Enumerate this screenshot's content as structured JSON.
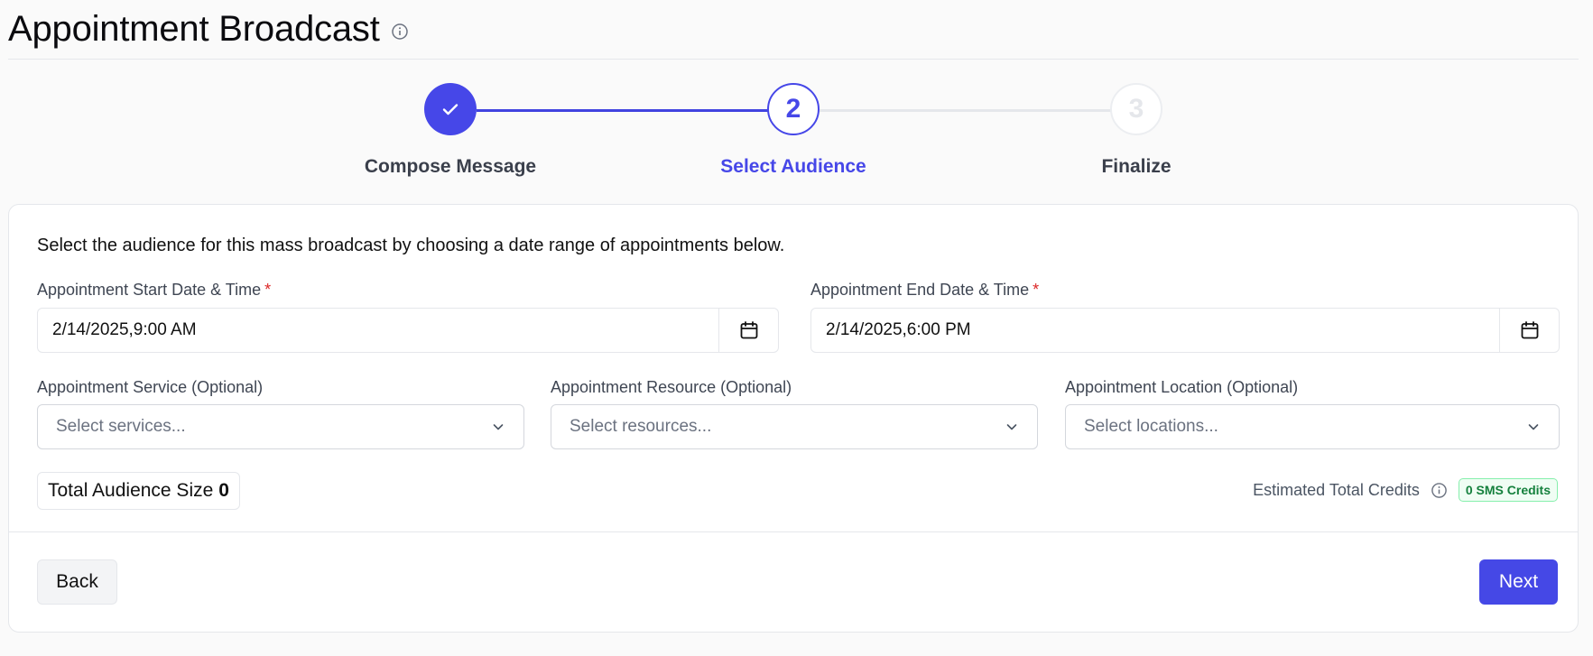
{
  "header": {
    "title": "Appointment Broadcast",
    "info_icon": "info-circle-icon"
  },
  "stepper": {
    "steps": [
      {
        "number": "",
        "label": "Compose Message",
        "state": "completed",
        "icon": "check-icon"
      },
      {
        "number": "2",
        "label": "Select Audience",
        "state": "active"
      },
      {
        "number": "3",
        "label": "Finalize",
        "state": "upcoming"
      }
    ]
  },
  "form": {
    "intro": "Select the audience for this mass broadcast by choosing a date range of appointments below.",
    "start": {
      "label": "Appointment Start Date & Time",
      "required_mark": "*",
      "value": "2/14/2025,9:00 AM",
      "icon": "calendar-icon"
    },
    "end": {
      "label": "Appointment End Date & Time",
      "required_mark": "*",
      "value": "2/14/2025,6:00 PM",
      "icon": "calendar-icon"
    },
    "service": {
      "label": "Appointment Service (Optional)",
      "placeholder": "Select services..."
    },
    "resource": {
      "label": "Appointment Resource (Optional)",
      "placeholder": "Select resources..."
    },
    "location": {
      "label": "Appointment Location (Optional)",
      "placeholder": "Select locations..."
    },
    "audience": {
      "label": "Total Audience Size",
      "count": "0"
    },
    "credits": {
      "label": "Estimated Total Credits",
      "badge": "0 SMS Credits",
      "badge_color": "#15803d"
    }
  },
  "actions": {
    "back": "Back",
    "next": "Next",
    "accent": "#4548e6"
  }
}
